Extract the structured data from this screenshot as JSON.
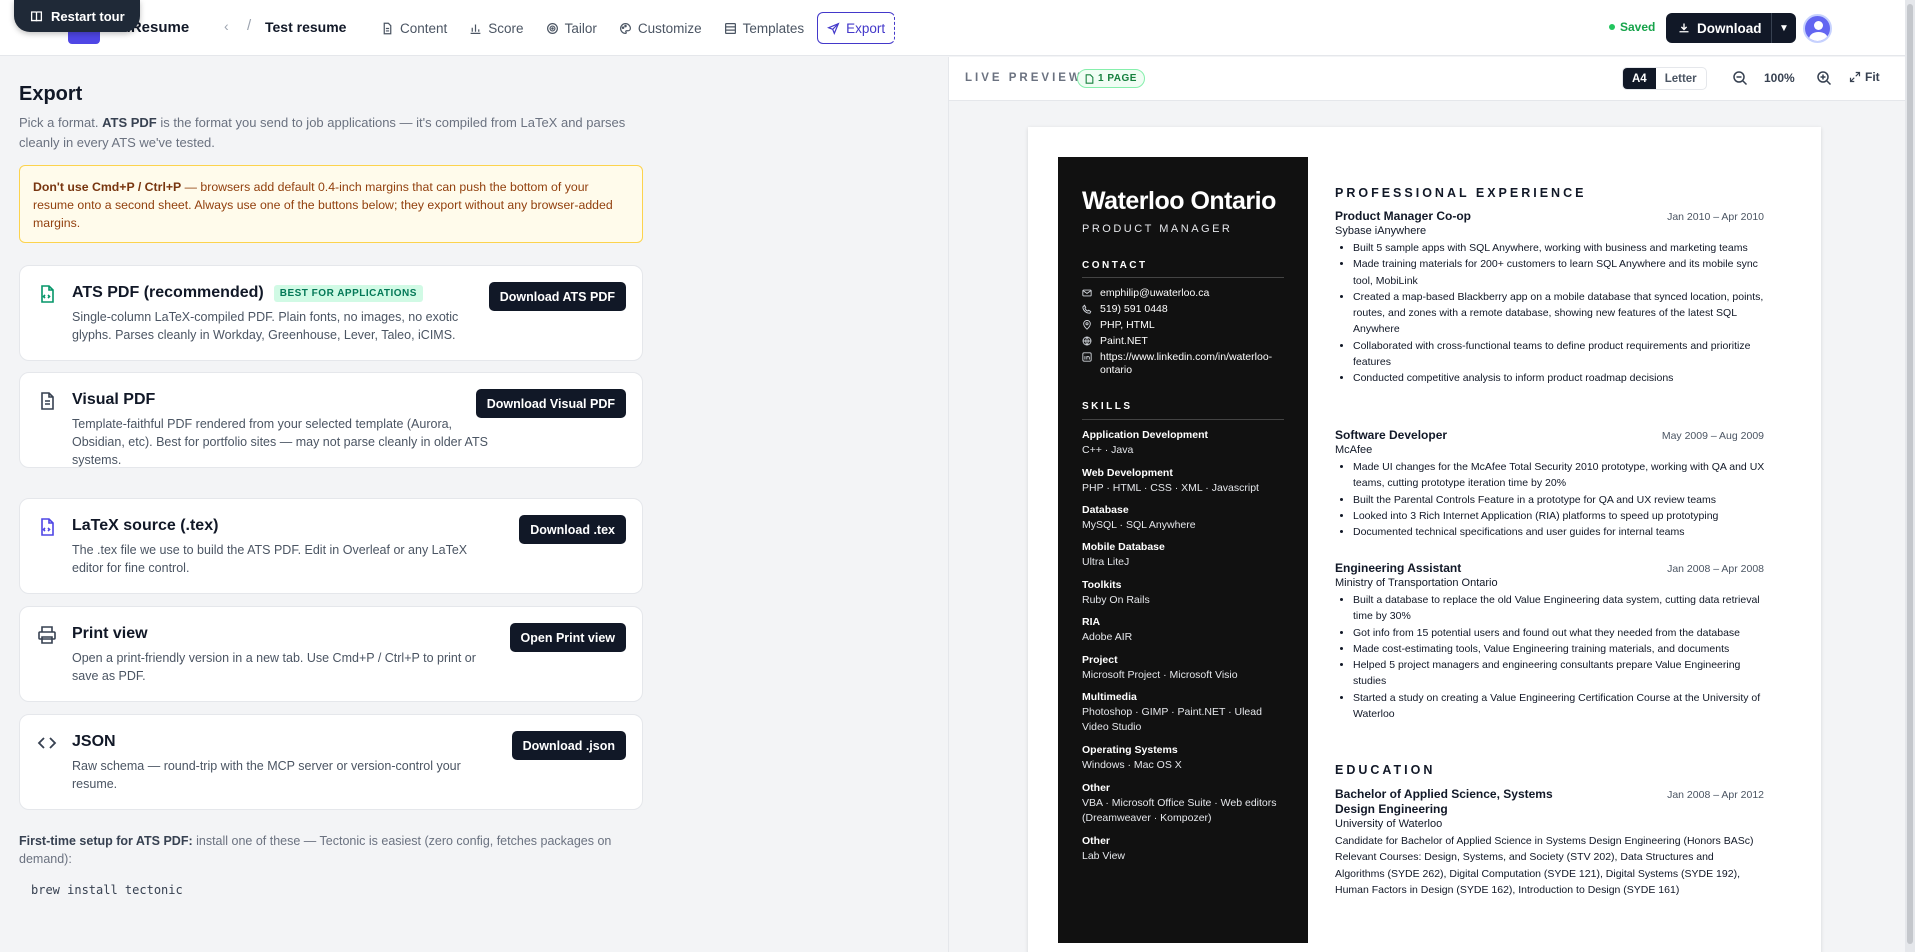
{
  "topbar": {
    "tour_label": "Restart tour",
    "brand": "cedResume",
    "doc_title": "Test resume",
    "nav": [
      {
        "label": "Content",
        "icon": "document-icon"
      },
      {
        "label": "Score",
        "icon": "bar-chart-icon"
      },
      {
        "label": "Tailor",
        "icon": "target-icon"
      },
      {
        "label": "Customize",
        "icon": "palette-icon"
      },
      {
        "label": "Templates",
        "icon": "grid-icon"
      },
      {
        "label": "Export",
        "icon": "send-icon"
      }
    ],
    "saved": "Saved",
    "download": "Download"
  },
  "export": {
    "title": "Export",
    "subtitle_pre": "Pick a format. ",
    "subtitle_bold": "ATS PDF",
    "subtitle_post": " is the format you send to job applications — it's compiled from LaTeX and parses cleanly in every ATS we've tested.",
    "warning_bold": "Don't use Cmd+P / Ctrl+P",
    "warning_text": " — browsers add default 0.4-inch margins that can push the bottom of your resume onto a second sheet. Always use one of the buttons below; they export without any browser-added margins.",
    "cards": [
      {
        "title": "ATS PDF (recommended)",
        "badge": "BEST FOR APPLICATIONS",
        "desc": "Single-column LaTeX-compiled PDF. Plain fonts, no images, no exotic glyphs. Parses cleanly in Workday, Greenhouse, Lever, Taleo, iCIMS.",
        "button": "Download ATS PDF"
      },
      {
        "title": "Visual PDF",
        "desc": "Template-faithful PDF rendered from your selected template (Aurora, Obsidian, etc). Best for portfolio sites — may not parse cleanly in older ATS systems.",
        "button": "Download Visual PDF"
      },
      {
        "title": "LaTeX source (.tex)",
        "desc": "The .tex file we use to build the ATS PDF. Edit in Overleaf or any LaTeX editor for fine control.",
        "button": "Download .tex"
      },
      {
        "title": "Print view",
        "desc": "Open a print-friendly version in a new tab. Use Cmd+P / Ctrl+P to print or save as PDF.",
        "button": "Open Print view"
      },
      {
        "title": "JSON",
        "desc": "Raw schema — round-trip with the MCP server or version-control your resume.",
        "button": "Download .json"
      }
    ],
    "setup_bold": "First-time setup for ATS PDF:",
    "setup_text": " install one of these — Tectonic is easiest (zero config, fetches packages on demand):",
    "code": "brew install tectonic"
  },
  "preview": {
    "label": "LIVE PREVIEW",
    "pages": "1 PAGE",
    "size_a4": "A4",
    "size_letter": "Letter",
    "zoom": "100%",
    "fit": "Fit"
  },
  "resume": {
    "name": "Waterloo Ontario",
    "role": "PRODUCT MANAGER",
    "contact_heading": "CONTACT",
    "contact": [
      {
        "icon": "mail-icon",
        "text": "emphilip@uwaterloo.ca"
      },
      {
        "icon": "phone-icon",
        "text": "519) 591 0448"
      },
      {
        "icon": "location-icon",
        "text": "PHP, HTML"
      },
      {
        "icon": "globe-icon",
        "text": "Paint.NET"
      },
      {
        "icon": "linkedin-icon",
        "text": "https://www.linkedin.com/in/waterloo-ontario"
      }
    ],
    "skills_heading": "SKILLS",
    "skills": [
      {
        "name": "Application Development",
        "value": "C++ · Java"
      },
      {
        "name": "Web Development",
        "value": "PHP · HTML · CSS · XML · Javascript"
      },
      {
        "name": "Database",
        "value": "MySQL · SQL Anywhere"
      },
      {
        "name": "Mobile Database",
        "value": "Ultra LiteJ"
      },
      {
        "name": "Toolkits",
        "value": "Ruby On Rails"
      },
      {
        "name": "RIA",
        "value": "Adobe AIR"
      },
      {
        "name": "Project",
        "value": "Microsoft Project · Microsoft Visio"
      },
      {
        "name": "Multimedia",
        "value": "Photoshop · GIMP · Paint.NET · Ulead Video Studio"
      },
      {
        "name": "Operating Systems",
        "value": "Windows · Mac OS X"
      },
      {
        "name": "Other",
        "value": "VBA · Microsoft Office Suite · Web editors (Dreamweaver · Kompozer)"
      },
      {
        "name": "Other",
        "value": "Lab View"
      }
    ],
    "experience_heading": "PROFESSIONAL EXPERIENCE",
    "jobs": [
      {
        "title": "Product Manager Co-op",
        "dates": "Jan 2010 – Apr 2010",
        "company": "Sybase iAnywhere",
        "bullets": [
          "Built 5 sample apps with SQL Anywhere, working with business and marketing teams",
          "Made training materials for 200+ customers to learn SQL Anywhere and its mobile sync tool, MobiLink",
          "Created a map-based Blackberry app on a mobile database that synced location, points, routes, and zones with a remote database, showing new features of the latest SQL Anywhere",
          "Collaborated with cross-functional teams to define product requirements and prioritize features",
          "Conducted competitive analysis to inform product roadmap decisions"
        ]
      },
      {
        "title": "Software Developer",
        "dates": "May 2009 – Aug 2009",
        "company": "McAfee",
        "bullets": [
          "Made UI changes for the McAfee Total Security 2010 prototype, working with QA and UX teams, cutting prototype iteration time by 20%",
          "Built the Parental Controls Feature in a prototype for QA and UX review teams",
          "Looked into 3 Rich Internet Application (RIA) platforms to speed up prototyping",
          "Documented technical specifications and user guides for internal teams"
        ]
      },
      {
        "title": "Engineering Assistant",
        "dates": "Jan 2008 – Apr 2008",
        "company": "Ministry of Transportation Ontario",
        "bullets": [
          "Built a database to replace the old Value Engineering data system, cutting data retrieval time by 30%",
          "Got info from 15 potential users and found out what they needed from the database",
          "Made cost-estimating tools, Value Engineering training materials, and documents",
          "Helped 5 project managers and engineering consultants prepare Value Engineering studies",
          "Started a study on creating a Value Engineering Certification Course at the University of Waterloo"
        ]
      }
    ],
    "education_heading": "EDUCATION",
    "education": {
      "degree": "Bachelor of Applied Science, Systems Design Engineering",
      "dates": "Jan 2008 – Apr 2012",
      "school": "University of Waterloo",
      "desc": "Candidate for Bachelor of Applied Science in Systems Design Engineering (Honors BASc) Relevant Courses: Design, Systems, and Society (STV 202), Data Structures and Algorithms (SYDE 262), Digital Computation (SYDE 121), Digital Systems (SYDE 192), Human Factors in Design (SYDE 162), Introduction to Design (SYDE 161)"
    }
  }
}
